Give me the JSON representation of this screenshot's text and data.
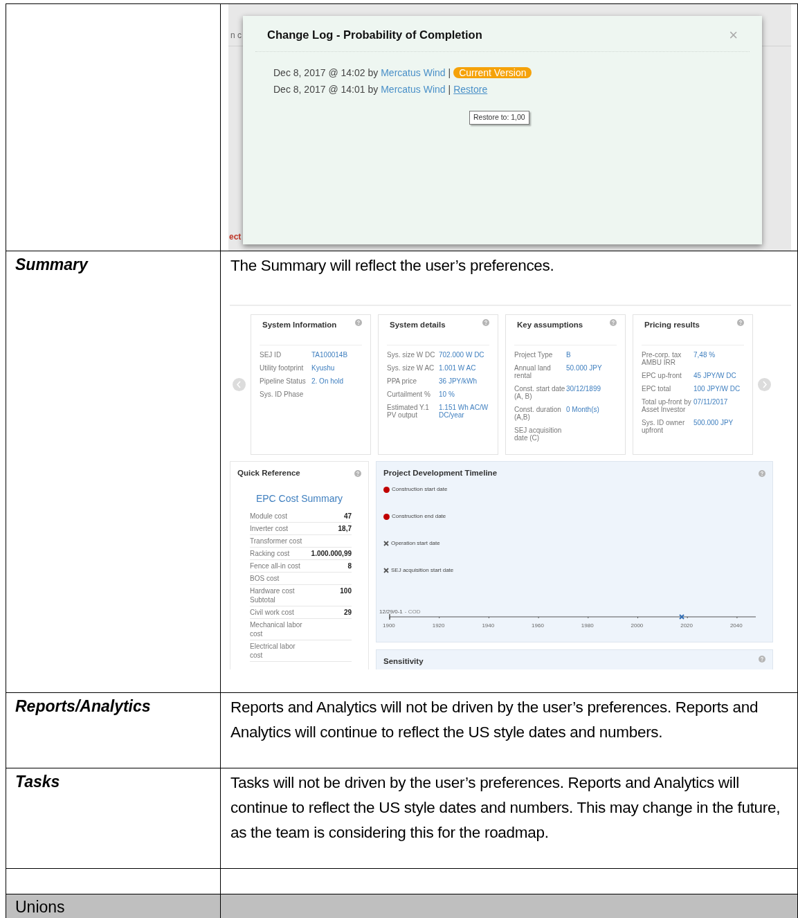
{
  "rows": [
    {
      "kind": "changelog",
      "changelog": {
        "background_fragments": [
          "n c",
          "ect"
        ],
        "title": "Change Log - Probability of Completion",
        "close": "×",
        "entries": [
          {
            "timestamp": "Dec 8, 2017 @ 14:02 by",
            "user": "Mercatus Wind",
            "separator": "|",
            "kind": "current",
            "action": "Current Version"
          },
          {
            "timestamp": "Dec 8, 2017 @ 14:01 by",
            "user": "Mercatus Wind",
            "separator": "|",
            "kind": "restore",
            "action": "Restore"
          }
        ],
        "tooltip": "Restore to: 1,00"
      }
    },
    {
      "kind": "summary",
      "heading": "Summary",
      "text": [
        "The Summary will reflect the user’s preferences."
      ],
      "dashboard": {
        "cards": [
          {
            "title": "System Information",
            "rows": [
              {
                "label": "SEJ ID",
                "value": "TA100014B"
              },
              {
                "label": "Utility footprint",
                "value": "Kyushu"
              },
              {
                "label": "Pipeline Status",
                "value": "2. On hold"
              },
              {
                "label": "Sys. ID Phase"
              }
            ]
          },
          {
            "title": "System details",
            "rows": [
              {
                "label": "Sys. size W DC",
                "value": "702.000 W DC"
              },
              {
                "label": "Sys. size W AC",
                "value": "1.001 W AC"
              },
              {
                "label": "PPA price",
                "value": "36 JPY/kWh"
              },
              {
                "label": "Curtailment %",
                "value": "10 %"
              },
              {
                "label": "Estimated Y.1 PV output",
                "value": "1.151 Wh AC/W DC/year"
              }
            ]
          },
          {
            "title": "Key assumptions",
            "rows": [
              {
                "label": "Project Type",
                "value": "B"
              },
              {
                "label": "Annual land rental",
                "value": "50.000 JPY"
              },
              {
                "label": "Const. start date (A, B)",
                "value": "30/12/1899"
              },
              {
                "label": "Const. duration (A,B)",
                "value": "0 Month(s)"
              },
              {
                "label": "SEJ acquisition date (C)"
              }
            ]
          },
          {
            "title": "Pricing results",
            "rows": [
              {
                "label": "Pre-corp. tax AMBU IRR",
                "value": "7,48 %"
              },
              {
                "label": "EPC up-front",
                "value": "45 JPY/W DC"
              },
              {
                "label": "EPC total",
                "value": "100 JPY/W DC"
              },
              {
                "label": "Total up-front by Asset Investor",
                "value": "07/11/2017"
              },
              {
                "label": "Sys. ID owner upfront",
                "value": "500.000 JPY"
              }
            ]
          }
        ],
        "quick_reference": {
          "title": "Quick Reference",
          "subtitle": "EPC Cost Summary",
          "rows": [
            {
              "label": "Module cost",
              "value": "47"
            },
            {
              "label": "Inverter cost",
              "value": "18,7"
            },
            {
              "label": "Transformer cost"
            },
            {
              "label": "Racking cost",
              "value": "1.000.000,99"
            },
            {
              "label": "Fence all-in cost",
              "value": "8"
            },
            {
              "label": "BOS cost"
            },
            {
              "label": "Hardware cost Subtotal",
              "value": "100"
            },
            {
              "label": "Civil work cost",
              "value": "29"
            },
            {
              "label": "Mechanical labor cost"
            },
            {
              "label": "Electrical labor cost"
            }
          ]
        },
        "timeline": {
          "title": "Project Development Timeline",
          "legend": [
            {
              "label": "Construction start date",
              "kind": "dot"
            },
            {
              "label": "Construction end date",
              "kind": "dot"
            },
            {
              "label": "Operation start date",
              "kind": "cross"
            },
            {
              "label": "SEJ acquisition start date",
              "kind": "cross"
            }
          ],
          "caption": "12/29/0-1",
          "caption_suffix": "- COD",
          "axis_labels": [
            "1900",
            "1920",
            "1940",
            "1960",
            "1980",
            "2000",
            "2020",
            "2040"
          ]
        },
        "sensitivity": {
          "title": "Sensitivity"
        }
      }
    },
    {
      "kind": "text",
      "heading": "Reports/Analytics",
      "text": [
        "Reports and Analytics will not be driven by the user’s preferences. Reports and Analytics will continue to reflect the US style dates and numbers."
      ]
    },
    {
      "kind": "text",
      "heading": "Tasks",
      "text": [
        "Tasks will not be driven by the user’s preferences.  Reports and Analytics will continue to reflect the US style dates and numbers. This may change in the future, as the team is considering this for the roadmap."
      ]
    },
    {
      "kind": "empty"
    },
    {
      "kind": "section",
      "heading": "Unions"
    }
  ]
}
